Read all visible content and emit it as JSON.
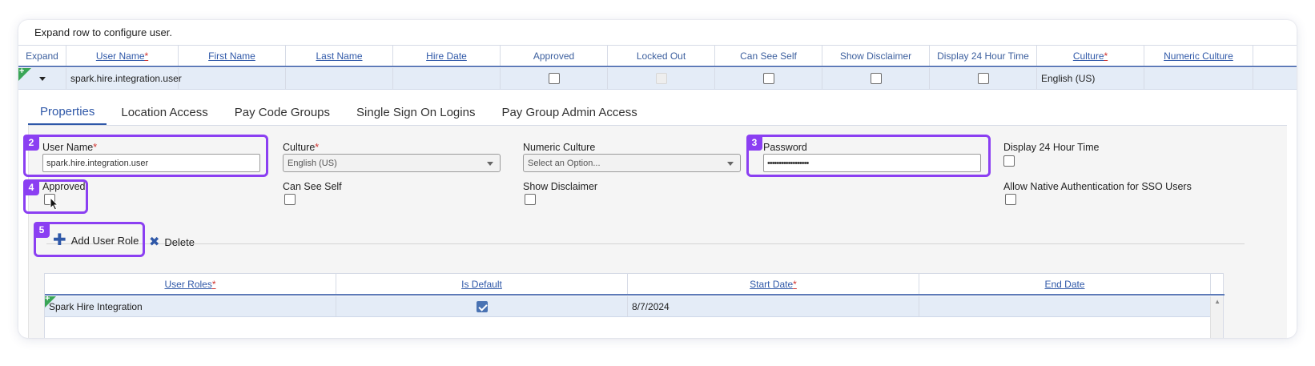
{
  "instruction": "Expand row to configure user.",
  "grid": {
    "headers": {
      "expand": "Expand",
      "user_name": "User Name",
      "first_name": "First Name",
      "last_name": "Last Name",
      "hire_date": "Hire Date",
      "approved": "Approved",
      "locked_out": "Locked Out",
      "can_see_self": "Can See Self",
      "show_disclaimer": "Show Disclaimer",
      "display_24": "Display 24 Hour Time",
      "culture": "Culture",
      "numeric_culture": "Numeric Culture"
    },
    "required_marker": "*",
    "row": {
      "user_name": "spark.hire.integration.user",
      "first_name": "",
      "last_name": "",
      "hire_date": "",
      "culture": "English (US)",
      "numeric_culture": "",
      "new_marker": "+"
    }
  },
  "tabs": [
    "Properties",
    "Location Access",
    "Pay Code Groups",
    "Single Sign On Logins",
    "Pay Group Admin Access"
  ],
  "form": {
    "user_name_label": "User Name",
    "user_name_value": "spark.hire.integration.user",
    "culture_label": "Culture",
    "culture_value": "English (US)",
    "numeric_culture_label": "Numeric Culture",
    "numeric_culture_placeholder": "Select an Option...",
    "password_label": "Password",
    "password_value": "••••••••••••••••••",
    "display24_label": "Display 24 Hour Time",
    "approved_label": "Approved",
    "can_see_self_label": "Can See Self",
    "show_disclaimer_label": "Show Disclaimer",
    "allow_native_label": "Allow Native Authentication for SSO Users"
  },
  "highlights": {
    "username": "2",
    "password": "3",
    "approved": "4",
    "add_role": "5"
  },
  "actions": {
    "add_user_role": "Add User Role",
    "delete": "Delete"
  },
  "roles_grid": {
    "headers": {
      "user_roles": "User Roles",
      "is_default": "Is Default",
      "start_date": "Start Date",
      "end_date": "End Date"
    },
    "row": {
      "user_role": "Spark Hire Integration",
      "start_date": "8/7/2024",
      "end_date": ""
    }
  },
  "colors": {
    "accent": "#2f58a8",
    "highlight": "#8b3ff2",
    "new_flag": "#3aa657",
    "required": "#d0312d"
  }
}
